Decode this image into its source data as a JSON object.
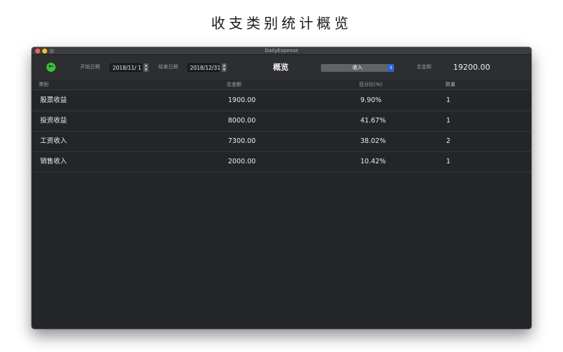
{
  "page": {
    "heading": "收支类别统计概览"
  },
  "window": {
    "title": "DailyExpense"
  },
  "toolbar": {
    "start_label": "开始日期",
    "start_date": "2018/11/  1",
    "end_label": "结束日期",
    "end_date": "2018/12/31",
    "overview_title": "概览",
    "type_select": "收入",
    "total_label": "总金额",
    "total_value": "19200.00"
  },
  "table": {
    "headers": [
      "类别",
      "总金额",
      "百分比(%)",
      "数量"
    ],
    "rows": [
      [
        "股票收益",
        "1900.00",
        "9.90%",
        "1"
      ],
      [
        "投资收益",
        "8000.00",
        "41.67%",
        "1"
      ],
      [
        "工资收入",
        "7300.00",
        "38.02%",
        "2"
      ],
      [
        "销售收入",
        "2000.00",
        "10.42%",
        "1"
      ]
    ]
  },
  "icons": {
    "back": "arrow-left-icon"
  },
  "colors": {
    "back_button": "#3fbf3b",
    "select_accent": "#2b64d8",
    "window_bg": "#232529"
  }
}
